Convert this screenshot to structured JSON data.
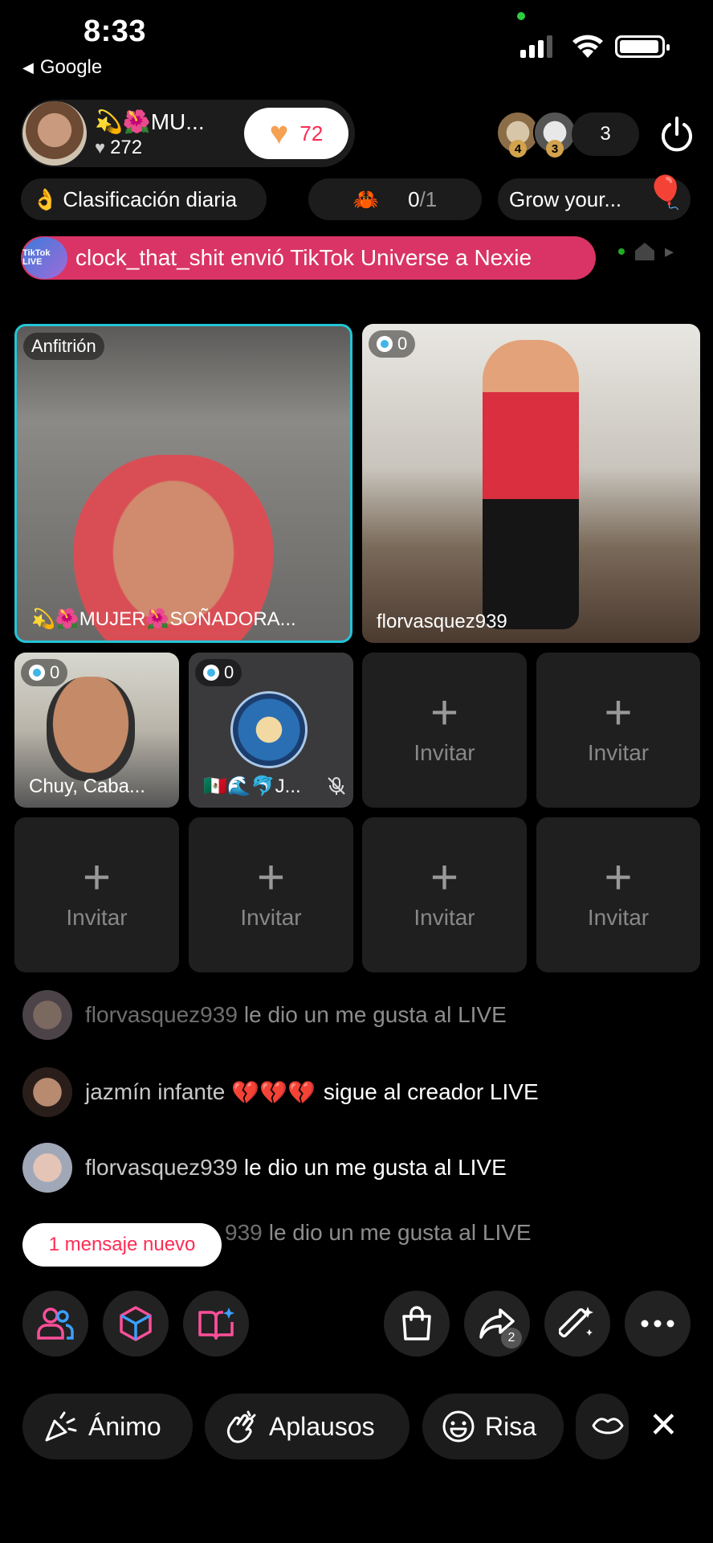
{
  "status": {
    "time": "8:33",
    "back_label": "Google",
    "back_glyph": "◀"
  },
  "host": {
    "name": "💫🌺MU...",
    "likes": "272",
    "likes_glyph": "♥",
    "follow_heart": "♥",
    "follow_count": "72"
  },
  "viewers": {
    "ranks": [
      "4",
      "3"
    ],
    "count": "3"
  },
  "pills": {
    "ranking_emoji": "👌",
    "ranking": "Clasificación diaria",
    "goal_emoji": "🦀",
    "goal_current": "0",
    "goal_total": "/1",
    "grow": "Grow your...",
    "grow_emoji": "🎈"
  },
  "gift_banner": {
    "icon_text": "TikTok LIVE",
    "text": "clock_that_shit envió TikTok Universe a Nexie"
  },
  "grid": {
    "host_label": "Anfitrión",
    "host_name": "💫🌺MUJER🌺SOÑADORA...",
    "guests": [
      {
        "coins": "0",
        "name": "florvasquez939"
      },
      {
        "coins": "0",
        "name": "Chuy, Caba..."
      },
      {
        "coins": "0",
        "name": "🇲🇽🌊🐬J..."
      }
    ],
    "invite_label": "Invitar",
    "plus": "+"
  },
  "comments": [
    {
      "user": "florvasquez939",
      "text": "le dio un me gusta al LIVE"
    },
    {
      "user": "jazmín infante",
      "emojis": "💔💔💔",
      "text": "sigue al creador LIVE"
    },
    {
      "user": "florvasquez939",
      "text": "le dio un me gusta al LIVE"
    },
    {
      "user": "939",
      "text": "le dio un me gusta al LIVE"
    }
  ],
  "new_message": "1 mensaje nuevo",
  "share_count": "2",
  "reactions": [
    {
      "label": "Ánimo",
      "icon": "cheer-icon"
    },
    {
      "label": "Aplausos",
      "icon": "clap-icon"
    },
    {
      "label": "Risa",
      "icon": "laugh-icon"
    }
  ],
  "close_glyph": "✕",
  "colors": {
    "accent_pink": "#fe2c55",
    "host_border": "#25c4d6",
    "banner": "#d93465"
  }
}
